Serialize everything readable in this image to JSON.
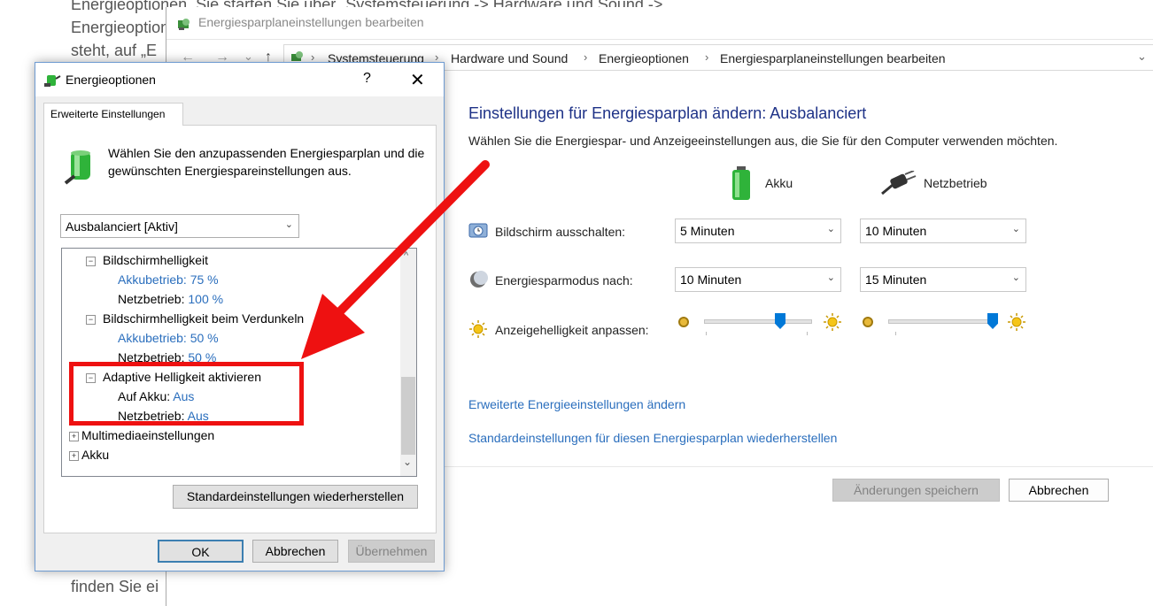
{
  "article": {
    "line1": "Energieoptionen. Sie starten Sie über „Systemsteuerung -> Hardware und Sound ->",
    "line2": "Energieoptionen",
    "line3": "steht, auf „E",
    "bottom": "finden Sie ei"
  },
  "mainwin": {
    "title": "Energiesparplaneinstellungen bearbeiten",
    "nav": {
      "back": "←",
      "forward": "→",
      "recent": "⌄",
      "up": "↑"
    },
    "breadcrumb": [
      "Systemsteuerung",
      "Hardware und Sound",
      "Energieoptionen",
      "Energiesparplaneinstellungen bearbeiten"
    ],
    "heading": "Einstellungen für Energiesparplan ändern: Ausbalanciert",
    "description": "Wählen Sie die Energiespar- und Anzeigeeinstellungen aus, die Sie für den Computer verwenden möchten.",
    "col_battery": "Akku",
    "col_power": "Netzbetrieb",
    "rows": {
      "display_off": {
        "label": "Bildschirm ausschalten:",
        "battery": "5 Minuten",
        "power": "10 Minuten"
      },
      "sleep": {
        "label": "Energiesparmodus nach:",
        "battery": "10 Minuten",
        "power": "15 Minuten"
      },
      "brightness": {
        "label": "Anzeigehelligkeit anpassen:",
        "battery_level": 0.72,
        "power_level": 0.98
      }
    },
    "link_advanced": "Erweiterte Energieeinstellungen ändern",
    "link_restore": "Standardeinstellungen für diesen Energiesparplan wiederherstellen",
    "save_button": "Änderungen speichern",
    "cancel_button": "Abbrechen"
  },
  "dialog": {
    "title": "Energieoptionen",
    "help": "?",
    "close": "✕",
    "tab": "Erweiterte Einstellungen",
    "intro": "Wählen Sie den anzupassenden Energiesparplan und die gewünschten Energiespareinstellungen aus.",
    "plan_select": "Ausbalanciert [Aktiv]",
    "tree": {
      "brightness": "Bildschirmhelligkeit",
      "brightness_battery_label": "Akkubetrieb:",
      "brightness_battery_value": "75 %",
      "brightness_power_label": "Netzbetrieb:",
      "brightness_power_value": "100 %",
      "dim": "Bildschirmhelligkeit beim Verdunkeln",
      "dim_battery_label": "Akkubetrieb:",
      "dim_battery_value": "50 %",
      "dim_power_label": "Netzbetrieb:",
      "dim_power_value": "50 %",
      "adaptive": "Adaptive Helligkeit aktivieren",
      "adaptive_battery_label": "Auf Akku:",
      "adaptive_battery_value": "Aus",
      "adaptive_power_label": "Netzbetrieb:",
      "adaptive_power_value": "Aus",
      "multimedia": "Multimediaeinstellungen",
      "battery": "Akku"
    },
    "restore_button": "Standardeinstellungen wiederherstellen",
    "ok_button": "OK",
    "cancel_button": "Abbrechen",
    "apply_button": "Übernehmen"
  }
}
